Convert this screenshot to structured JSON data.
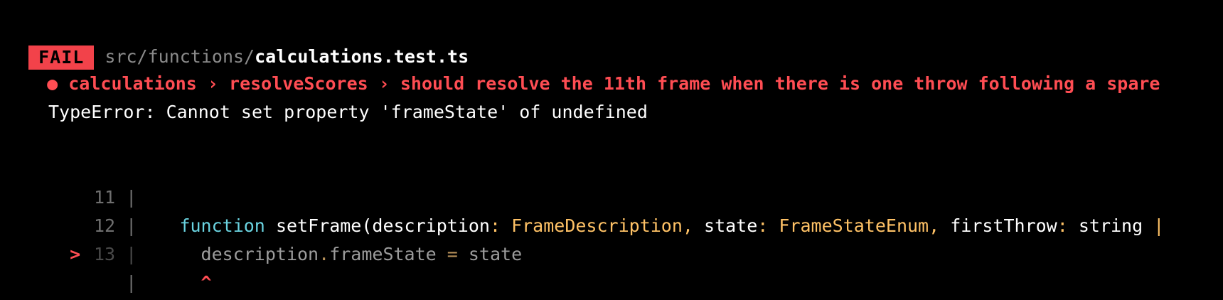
{
  "header": {
    "badge": "FAIL",
    "path_dim": "src/functions/",
    "path_file": "calculations.test.ts"
  },
  "test_title": {
    "bullet": "●",
    "describe": "calculations",
    "sep1": " › ",
    "sub": "resolveScores",
    "sep2": " › ",
    "name": "should resolve the 11th frame when there is one throw following a spare"
  },
  "error": {
    "message": "TypeError: Cannot set property 'frameState' of undefined"
  },
  "code_frame": {
    "lines": [
      {
        "marker": "",
        "number": "11",
        "pipe": "|",
        "code": ""
      },
      {
        "marker": "",
        "number": "12",
        "pipe": "|",
        "tokens": {
          "indent": "    ",
          "keyword": "function",
          "sp": " ",
          "fname": "setFrame(description",
          "colon1": ": ",
          "type1": "FrameDescription",
          "comma1": ", ",
          "param2": "state",
          "colon2": ": ",
          "type2": "FrameStateEnum",
          "comma2": ", ",
          "param3": "firstThrow",
          "colon3": ": ",
          "type3": "string",
          "trail": " |"
        }
      },
      {
        "marker": ">",
        "number": "13",
        "pipe": "|",
        "tokens": {
          "indent": "      ",
          "obj": "description",
          "dot": ".",
          "prop": "frameState",
          "eq": " = ",
          "val": "state"
        }
      },
      {
        "marker": "",
        "number": "",
        "pipe": "|",
        "caret": "^"
      }
    ]
  },
  "colors": {
    "background": "#000000",
    "fail_badge": "#f2424a",
    "error_red": "#ff4d53",
    "keyword_cyan": "#6ad3e0",
    "type_orange": "#ffc266"
  }
}
